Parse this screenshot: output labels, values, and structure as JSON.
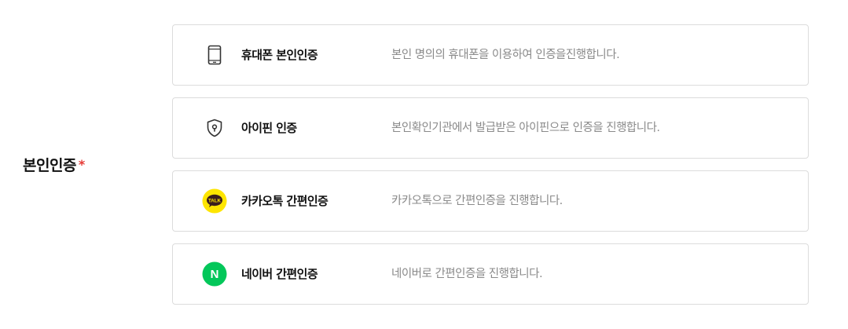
{
  "field": {
    "label": "본인인증",
    "required_mark": "*"
  },
  "options": [
    {
      "title": "휴대폰 본인인증",
      "description": "본인 명의의 휴대폰을 이용하여 인증을진행합니다.",
      "icon": "mobile-phone-icon"
    },
    {
      "title": "아이핀 인증",
      "description": "본인확인기관에서 발급받은 아이핀으로 인증을 진행합니다.",
      "icon": "shield-lock-icon"
    },
    {
      "title": "카카오톡 간편인증",
      "description": "카카오톡으로 간편인증을 진행합니다.",
      "icon": "kakaotalk-icon",
      "icon_text": "TALK"
    },
    {
      "title": "네이버 간편인증",
      "description": "네이버로 간편인증을 진행합니다.",
      "icon": "naver-icon",
      "icon_text": "N"
    }
  ],
  "colors": {
    "required": "#e53935",
    "kakao_yellow": "#fee500",
    "kakao_brown": "#3a1d1d",
    "naver_green": "#03c75a",
    "border": "#dcdcdc",
    "description_text": "#8a8a8a"
  }
}
